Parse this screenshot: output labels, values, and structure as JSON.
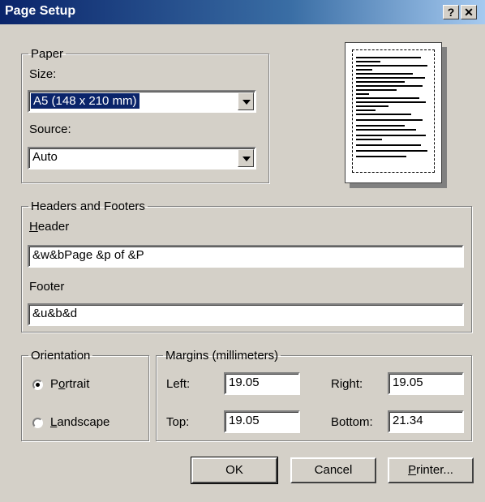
{
  "window": {
    "title": "Page Setup",
    "help_label": "?",
    "close_label": "✕"
  },
  "paper": {
    "legend": "Paper",
    "size_label": "Size:",
    "size_value": "A5 (148 x 210 mm)",
    "source_label": "Source:",
    "source_value": "Auto"
  },
  "headers_footers": {
    "legend": "Headers and Footers",
    "header_label_accel": "H",
    "header_label_rest": "eader",
    "header_value": "&w&bPage &p of &P",
    "footer_label": "Footer",
    "footer_value": "&u&b&d"
  },
  "orientation": {
    "legend": "Orientation",
    "portrait_pre": "P",
    "portrait_accel": "o",
    "portrait_post": "rtrait",
    "landscape_accel": "L",
    "landscape_post": "andscape",
    "selected": "portrait"
  },
  "margins": {
    "legend": "Margins (millimeters)",
    "left_label": "Left:",
    "left_value": "19.05",
    "right_label": "Right:",
    "right_value": "19.05",
    "top_label": "Top:",
    "top_value": "19.05",
    "bottom_label": "Bottom:",
    "bottom_value": "21.34"
  },
  "buttons": {
    "ok": "OK",
    "cancel": "Cancel",
    "printer_accel": "P",
    "printer_rest": "rinter..."
  }
}
